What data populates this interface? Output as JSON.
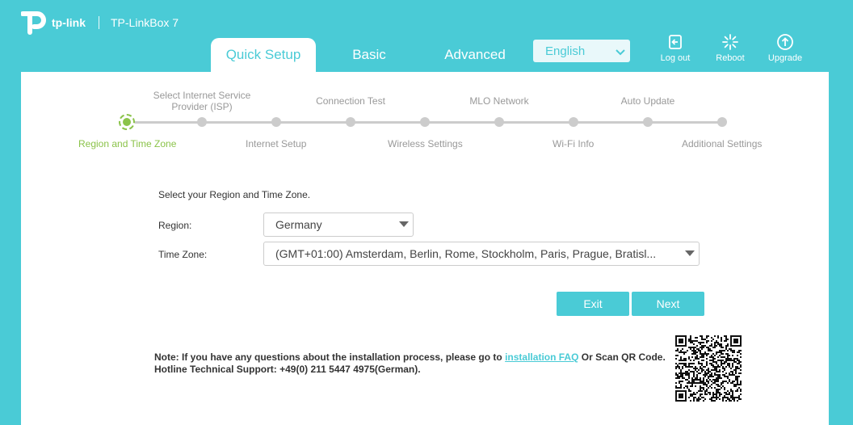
{
  "header": {
    "brand": "tp-link",
    "model": "TP-LinkBox 7",
    "tabs": [
      {
        "label": "Quick Setup"
      },
      {
        "label": "Basic"
      },
      {
        "label": "Advanced"
      }
    ],
    "language": {
      "selected": "English"
    },
    "buttons": {
      "logout": "Log out",
      "reboot": "Reboot",
      "upgrade": "Upgrade"
    }
  },
  "steps": {
    "top": [
      "Select Internet Service Provider (ISP)",
      "Connection Test",
      "MLO Network",
      "Auto Update"
    ],
    "bottom": [
      "Region and Time Zone",
      "Internet Setup",
      "Wireless Settings",
      "Wi-Fi Info",
      "Additional Settings"
    ]
  },
  "form": {
    "intro": "Select your Region and Time Zone.",
    "region_label": "Region:",
    "region_value": "Germany",
    "timezone_label": "Time Zone:",
    "timezone_value": "(GMT+01:00) Amsterdam, Berlin, Rome, Stockholm, Paris, Prague, Bratisl..."
  },
  "actions": {
    "exit": "Exit",
    "next": "Next"
  },
  "note": {
    "line1_prefix": "Note: If you have any questions about the installation process, please go to",
    "link": "installation FAQ",
    "line1_suffix": "Or Scan QR Code.",
    "line2": "Hotline Technical Support: +49(0) 211 5447 4975(German)."
  },
  "colors": {
    "brand": "#4acbd6",
    "active_step": "#8bc34a",
    "inactive": "#cccccc"
  }
}
